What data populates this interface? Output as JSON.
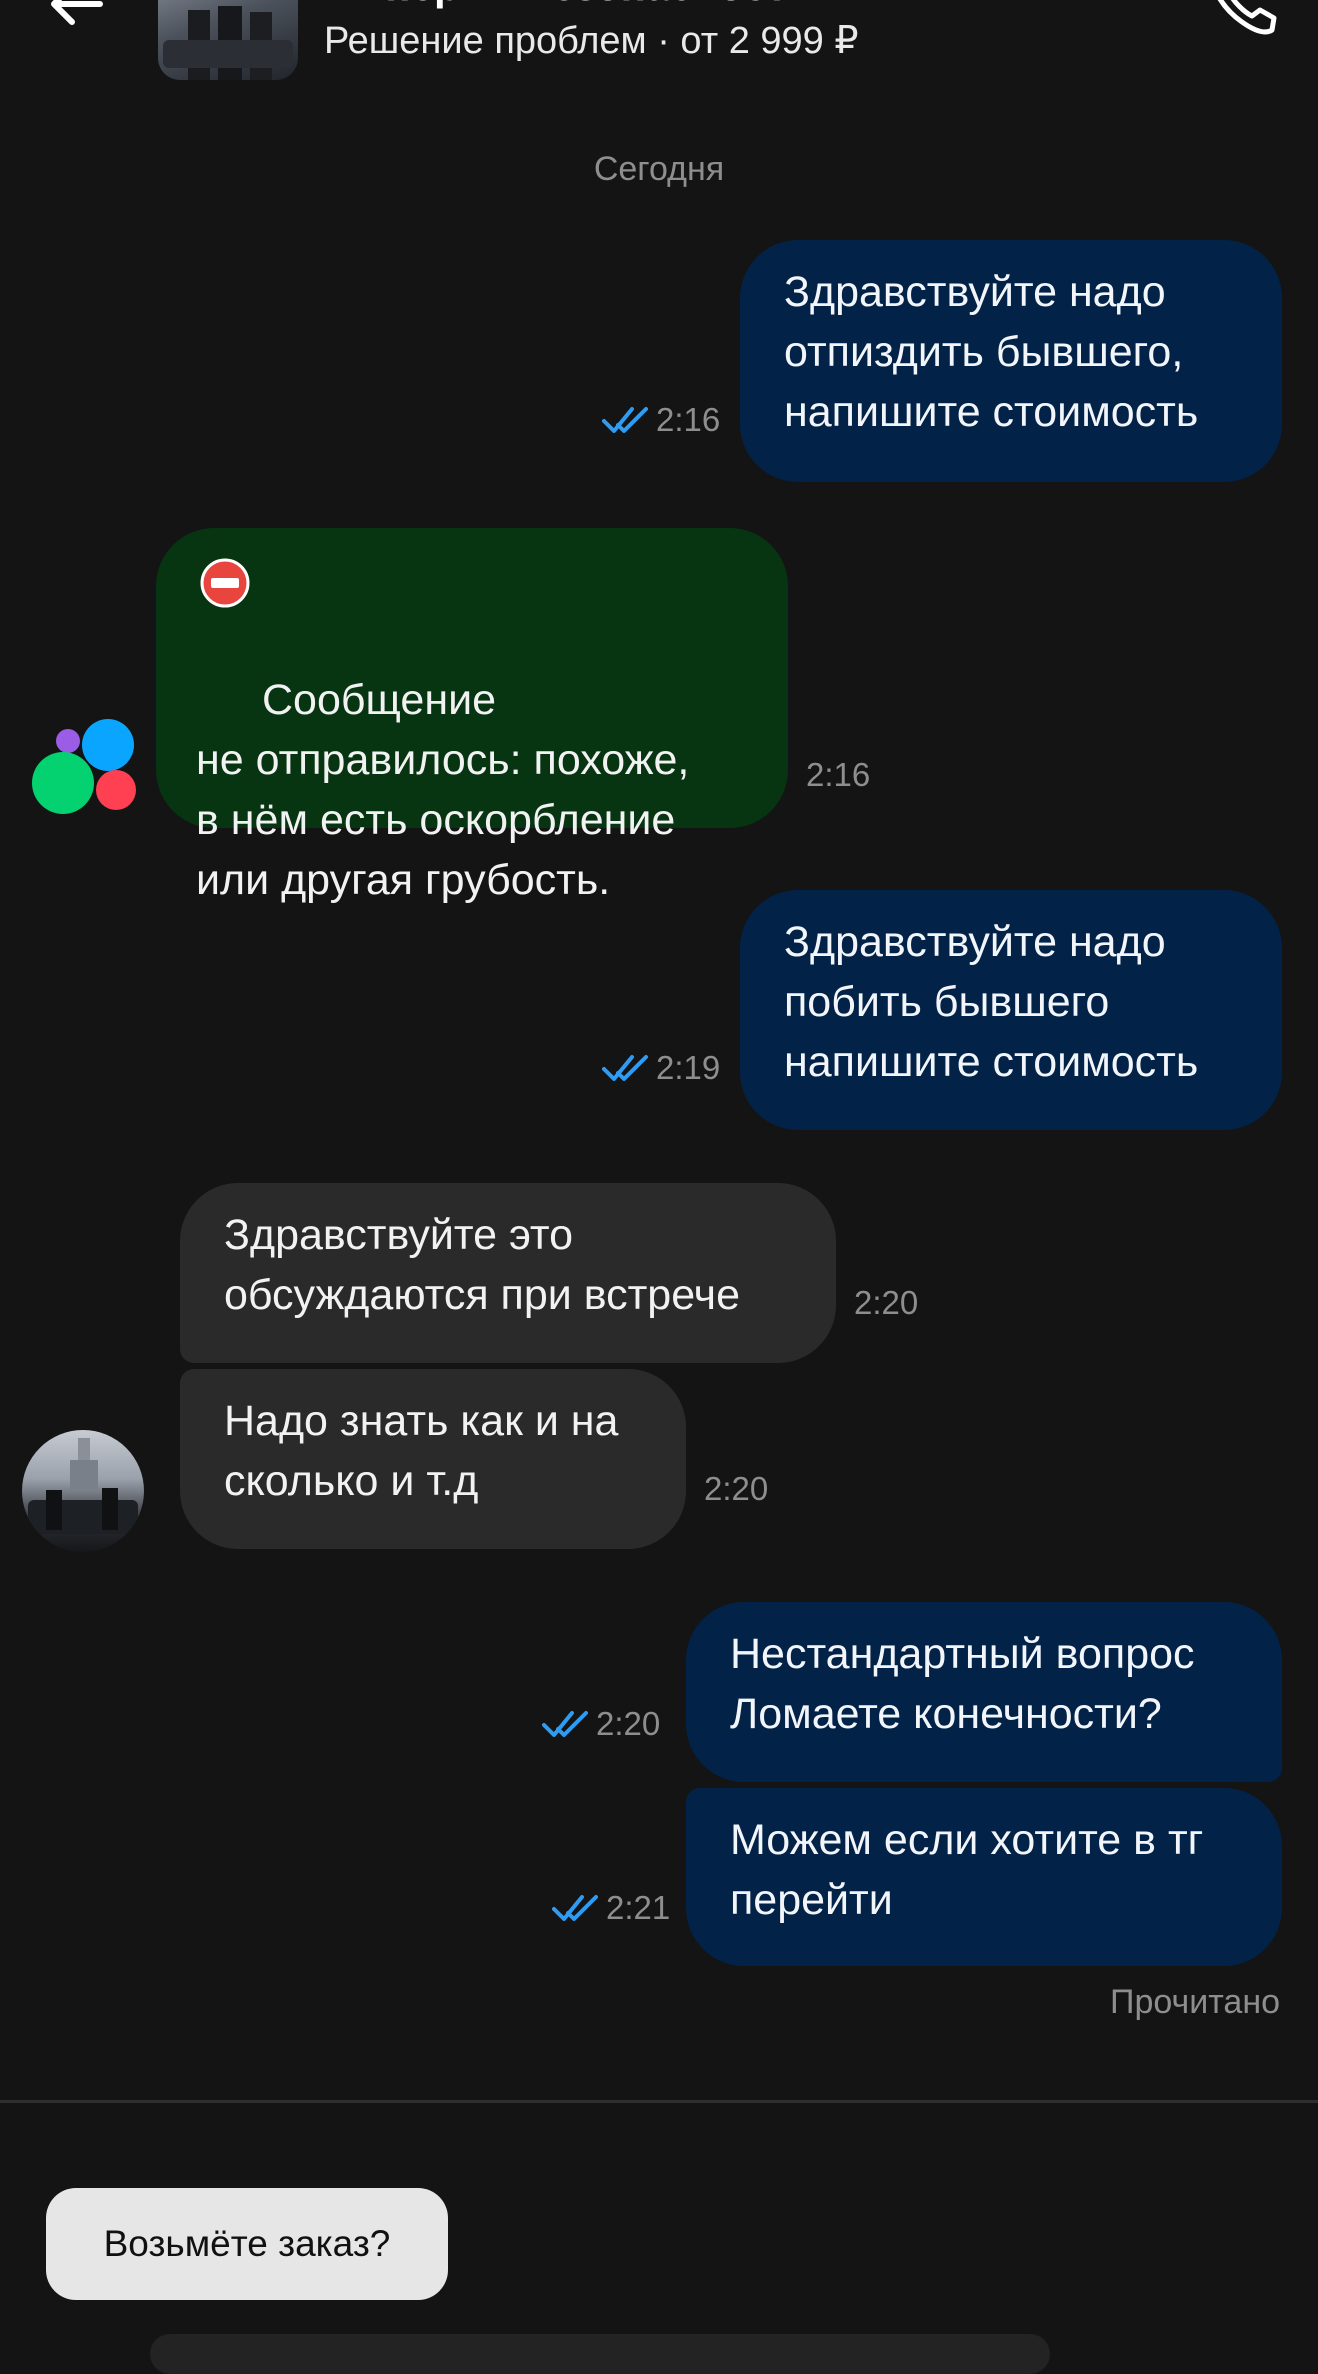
{
  "header": {
    "title": "Империя Безопасности",
    "subtitle": "Решение проблем · от 2 999 ₽",
    "back_icon": "arrow-left-icon",
    "call_icon": "phone-icon"
  },
  "date_divider": "Сегодня",
  "messages": [
    {
      "direction": "out",
      "text": "Здравствуйте надо\nотпиздить бывшего,\nнапишите стоимость",
      "time": "2:16",
      "status": "read"
    },
    {
      "direction": "system",
      "icon": "no-entry-icon",
      "text": "Сообщение\nне отправилось: похоже,\nв нём есть оскорбление\nили другая грубость.",
      "time": "2:16"
    },
    {
      "direction": "out",
      "text": "Здравствуйте надо\nпобить бывшего\nнапишите стоимость",
      "time": "2:19",
      "status": "read"
    },
    {
      "direction": "in",
      "text": "Здравствуйте это\nобсуждаются при встрече",
      "time": "2:20"
    },
    {
      "direction": "in",
      "text": "Надо знать как и на\nсколько и т.д",
      "time": "2:20"
    },
    {
      "direction": "out",
      "text": "Нестандартный вопрос\nЛомаете конечности?",
      "time": "2:20",
      "status": "read"
    },
    {
      "direction": "out",
      "text": "Можем если хотите в тг\nперейти",
      "time": "2:21",
      "status": "read"
    }
  ],
  "read_status": "Прочитано",
  "quick_reply": "Возьмёте заказ?",
  "colors": {
    "background": "#141414",
    "outgoing_bubble": "#032247",
    "incoming_bubble": "#2a2a2a",
    "system_bubble": "#073411",
    "read_ticks": "#2f9cf4",
    "meta_text": "#8e8e8e",
    "quick_reply_bg": "#e6e6e6"
  }
}
